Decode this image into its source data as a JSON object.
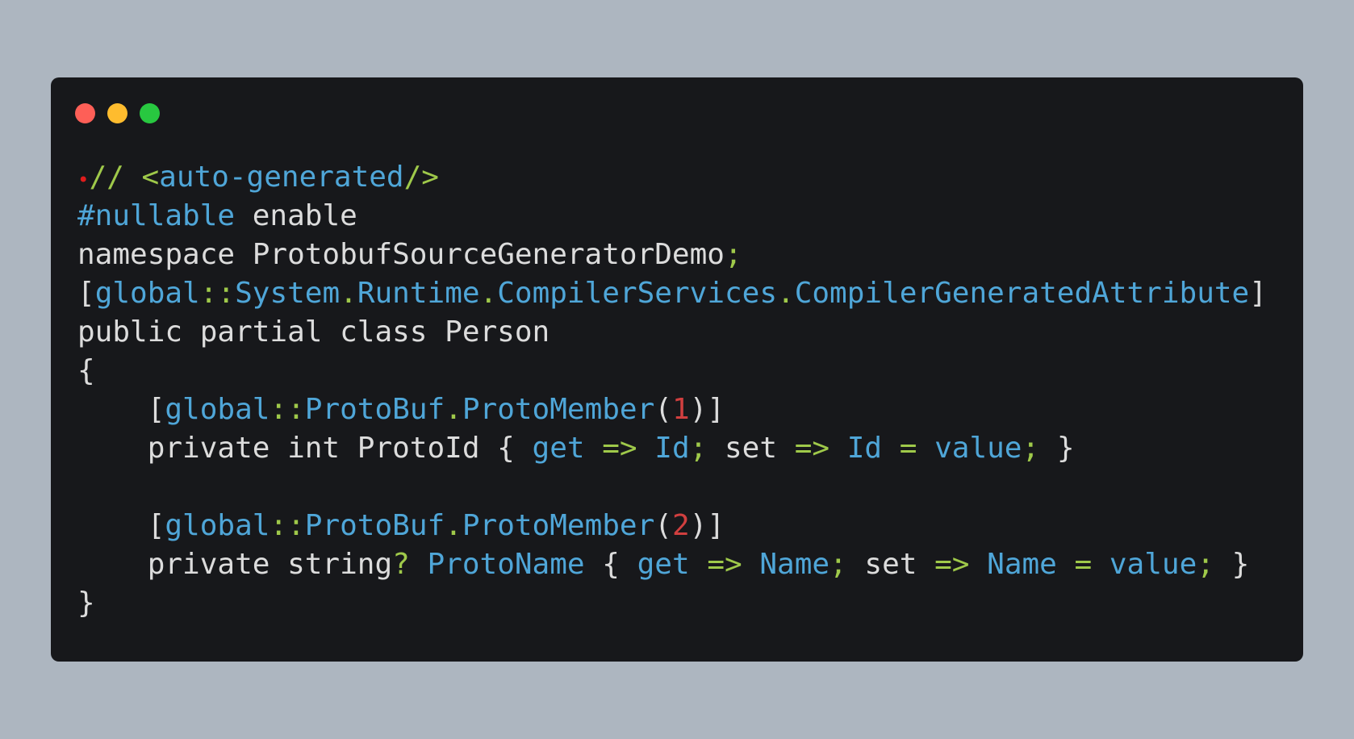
{
  "window": {
    "colors": {
      "background": "#17181b",
      "page_background": "#adb6c0",
      "dot_close": "#fe5f57",
      "dot_minimize": "#febc2e",
      "dot_maximize": "#28c840"
    }
  },
  "code": {
    "colors": {
      "plain": "#dcdcdc",
      "identifier": "#4fa6d8",
      "punctuation": "#9fc94a",
      "number": "#d13f3f"
    },
    "lines": [
      [
        {
          "t": "•",
          "c": "marker"
        },
        {
          "t": "// ",
          "c": "g"
        },
        {
          "t": "<",
          "c": "g"
        },
        {
          "t": "auto-generated",
          "c": "b"
        },
        {
          "t": "/>",
          "c": "g"
        }
      ],
      [
        {
          "t": "#nullable",
          "c": "b"
        },
        {
          "t": " enable",
          "c": "p"
        }
      ],
      [
        {
          "t": "namespace ProtobufSourceGeneratorDemo",
          "c": "p"
        },
        {
          "t": ";",
          "c": "g"
        }
      ],
      [
        {
          "t": "[",
          "c": "p"
        },
        {
          "t": "global",
          "c": "b"
        },
        {
          "t": "::",
          "c": "g"
        },
        {
          "t": "System",
          "c": "b"
        },
        {
          "t": ".",
          "c": "g"
        },
        {
          "t": "Runtime",
          "c": "b"
        },
        {
          "t": ".",
          "c": "g"
        },
        {
          "t": "CompilerServices",
          "c": "b"
        },
        {
          "t": ".",
          "c": "g"
        },
        {
          "t": "CompilerGeneratedAttribute",
          "c": "b"
        },
        {
          "t": "]",
          "c": "p"
        }
      ],
      [
        {
          "t": "public partial class Person",
          "c": "p"
        }
      ],
      [
        {
          "t": "{",
          "c": "p"
        }
      ],
      [
        {
          "t": "    [",
          "c": "p"
        },
        {
          "t": "global",
          "c": "b"
        },
        {
          "t": "::",
          "c": "g"
        },
        {
          "t": "ProtoBuf",
          "c": "b"
        },
        {
          "t": ".",
          "c": "g"
        },
        {
          "t": "ProtoMember",
          "c": "b"
        },
        {
          "t": "(",
          "c": "p"
        },
        {
          "t": "1",
          "c": "r"
        },
        {
          "t": ")]",
          "c": "p"
        }
      ],
      [
        {
          "t": "    private int ProtoId { ",
          "c": "p"
        },
        {
          "t": "get",
          "c": "b"
        },
        {
          "t": " => ",
          "c": "g"
        },
        {
          "t": "Id",
          "c": "b"
        },
        {
          "t": ";",
          "c": "g"
        },
        {
          "t": " set",
          "c": "p"
        },
        {
          "t": " => ",
          "c": "g"
        },
        {
          "t": "Id",
          "c": "b"
        },
        {
          "t": " = ",
          "c": "g"
        },
        {
          "t": "value",
          "c": "b"
        },
        {
          "t": ";",
          "c": "g"
        },
        {
          "t": " }",
          "c": "p"
        }
      ],
      [],
      [
        {
          "t": "    [",
          "c": "p"
        },
        {
          "t": "global",
          "c": "b"
        },
        {
          "t": "::",
          "c": "g"
        },
        {
          "t": "ProtoBuf",
          "c": "b"
        },
        {
          "t": ".",
          "c": "g"
        },
        {
          "t": "ProtoMember",
          "c": "b"
        },
        {
          "t": "(",
          "c": "p"
        },
        {
          "t": "2",
          "c": "r"
        },
        {
          "t": ")]",
          "c": "p"
        }
      ],
      [
        {
          "t": "    private string",
          "c": "p"
        },
        {
          "t": "?",
          "c": "g"
        },
        {
          "t": " ProtoName",
          "c": "b"
        },
        {
          "t": " { ",
          "c": "p"
        },
        {
          "t": "get",
          "c": "b"
        },
        {
          "t": " => ",
          "c": "g"
        },
        {
          "t": "Name",
          "c": "b"
        },
        {
          "t": ";",
          "c": "g"
        },
        {
          "t": " set",
          "c": "p"
        },
        {
          "t": " => ",
          "c": "g"
        },
        {
          "t": "Name",
          "c": "b"
        },
        {
          "t": " = ",
          "c": "g"
        },
        {
          "t": "value",
          "c": "b"
        },
        {
          "t": ";",
          "c": "g"
        },
        {
          "t": " }",
          "c": "p"
        }
      ],
      [
        {
          "t": "}",
          "c": "p"
        }
      ]
    ]
  }
}
